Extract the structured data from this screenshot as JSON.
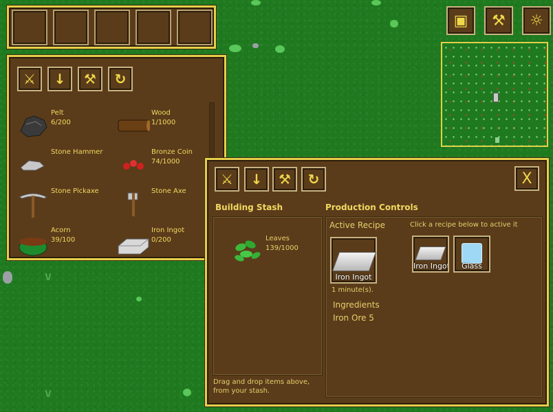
{
  "hotbar": {
    "slots": 5
  },
  "hud_buttons": [
    {
      "icon": "chest-icon",
      "glyph": "▣"
    },
    {
      "icon": "hammer-icon",
      "glyph": "⚒"
    },
    {
      "icon": "lightbulb-icon",
      "glyph": "☼"
    }
  ],
  "inventory": {
    "tools": [
      {
        "icon": "pickaxe-icon",
        "glyph": "⚔"
      },
      {
        "icon": "sword-icon",
        "glyph": "↓"
      },
      {
        "icon": "hammer-icon",
        "glyph": "⚒"
      },
      {
        "icon": "rotate-icon",
        "glyph": "↻"
      }
    ],
    "items": [
      {
        "name": "Pelt",
        "qty": "6/200"
      },
      {
        "name": "Wood",
        "qty": "1/1000"
      },
      {
        "name": "Stone Hammer",
        "qty": ""
      },
      {
        "name": "Bronze Coin",
        "qty": "74/1000"
      },
      {
        "name": "Stone Pickaxe",
        "qty": ""
      },
      {
        "name": "Stone Axe",
        "qty": ""
      },
      {
        "name": "Acorn",
        "qty": "39/100"
      },
      {
        "name": "Iron Ingot",
        "qty": "0/200"
      }
    ]
  },
  "production": {
    "tools": [
      {
        "icon": "pickaxe-icon",
        "glyph": "⚔"
      },
      {
        "icon": "sword-icon",
        "glyph": "↓"
      },
      {
        "icon": "hammer-icon",
        "glyph": "⚒"
      },
      {
        "icon": "rotate-icon",
        "glyph": "↻"
      }
    ],
    "close_glyph": "X",
    "stash_title": "Building Stash",
    "stash_item": {
      "name": "Leaves",
      "qty": "139/1000"
    },
    "stash_hint": "Drag and drop items above, from your stash.",
    "controls_title": "Production Controls",
    "active_recipe_label": "Active Recipe",
    "recipe_hint": "Click a recipe below to active it",
    "active_recipe": {
      "name": "Iron Ingot",
      "time": "1 minute(s)."
    },
    "ingredients_label": "Ingredients",
    "ingredients": [
      "Iron Ore 5"
    ],
    "recipes": [
      {
        "name": "Iron Ingot"
      },
      {
        "name": "Glass"
      }
    ]
  },
  "colors": {
    "grass": "#1f7a1f",
    "panel": "#5a3c1b",
    "gold_border": "#e6cf4a",
    "text_gold": "#f2d860"
  }
}
